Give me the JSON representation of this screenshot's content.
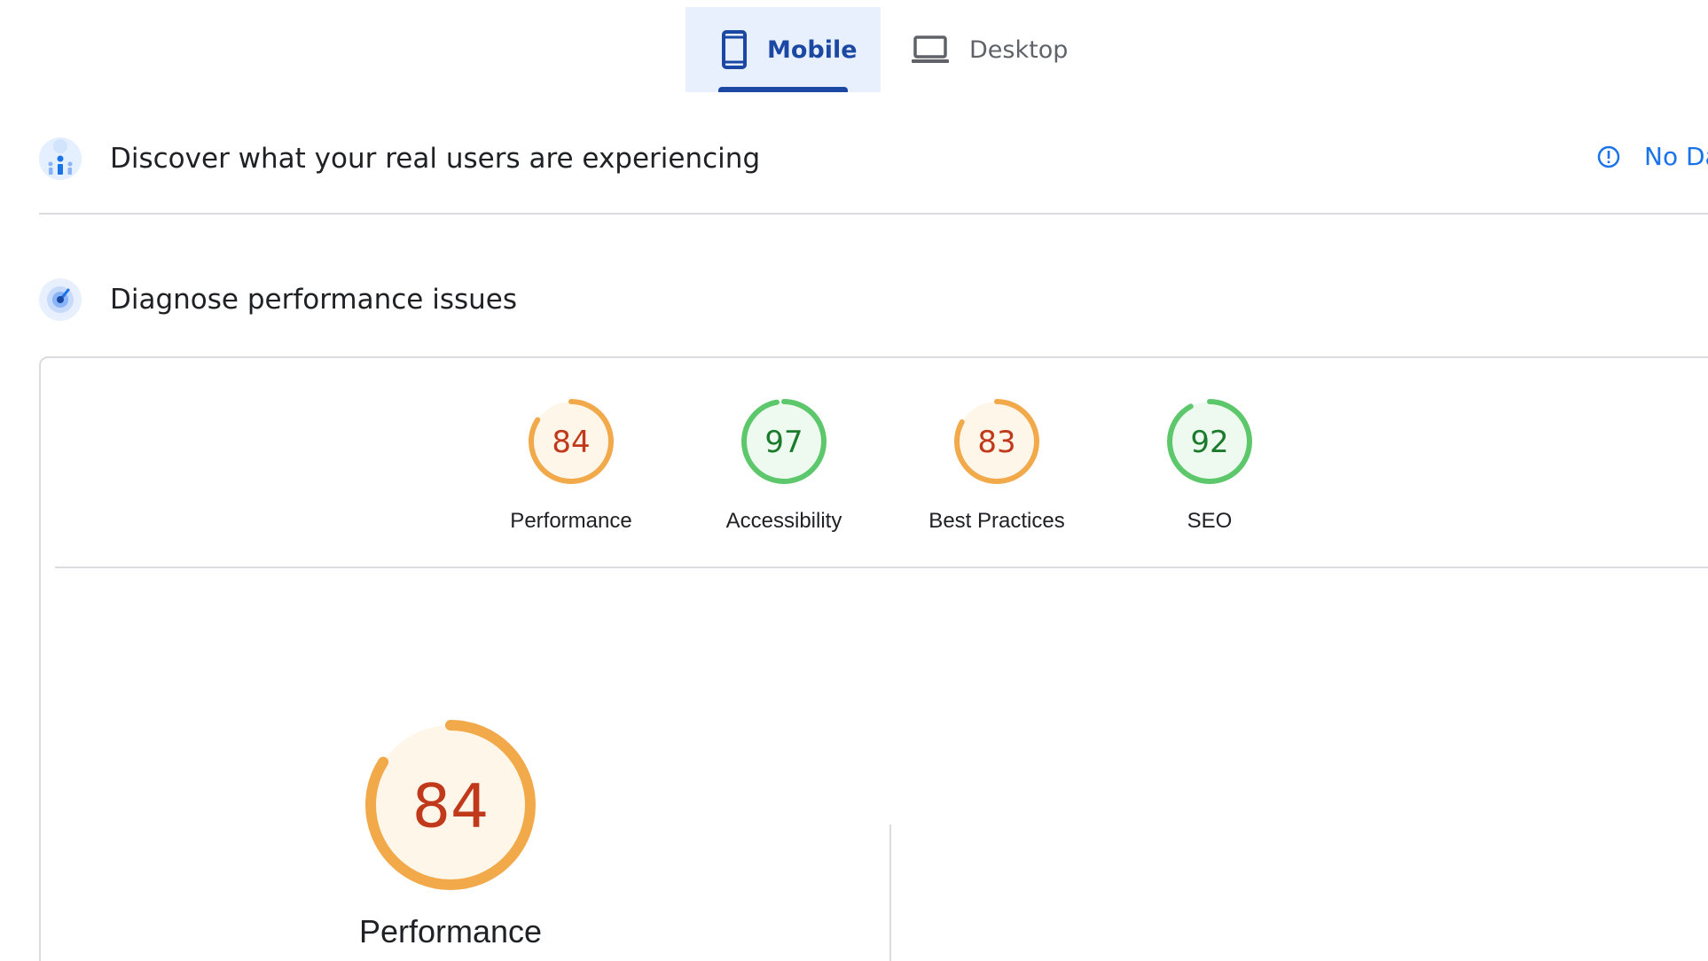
{
  "tabs": {
    "mobile": {
      "label": "Mobile",
      "icon": "smartphone-icon",
      "selected": true
    },
    "desktop": {
      "label": "Desktop",
      "icon": "laptop-icon",
      "selected": false
    }
  },
  "field_data": {
    "title": "Discover what your real users are experiencing",
    "icon": "users-chart-icon",
    "status_label": "No Da",
    "status_icon": "info-icon"
  },
  "lab_data": {
    "title": "Diagnose performance issues",
    "icon": "radar-icon"
  },
  "scores": [
    {
      "label": "Performance",
      "value": "84",
      "score": 84,
      "rating": "average"
    },
    {
      "label": "Accessibility",
      "value": "97",
      "score": 97,
      "rating": "pass"
    },
    {
      "label": "Best Practices",
      "value": "83",
      "score": 83,
      "rating": "average"
    },
    {
      "label": "SEO",
      "value": "92",
      "score": 92,
      "rating": "pass"
    }
  ],
  "performance_detail": {
    "label": "Performance",
    "value": "84",
    "score": 84,
    "rating": "average"
  },
  "colors": {
    "average_stroke": "#f1a94a",
    "average_fill": "#fff6ea",
    "average_text": "#c0391b",
    "pass_stroke": "#5dc76c",
    "pass_fill": "#eefaef",
    "pass_text": "#1b7a2b",
    "accent": "#1a48a3",
    "link": "#1a73e8"
  }
}
